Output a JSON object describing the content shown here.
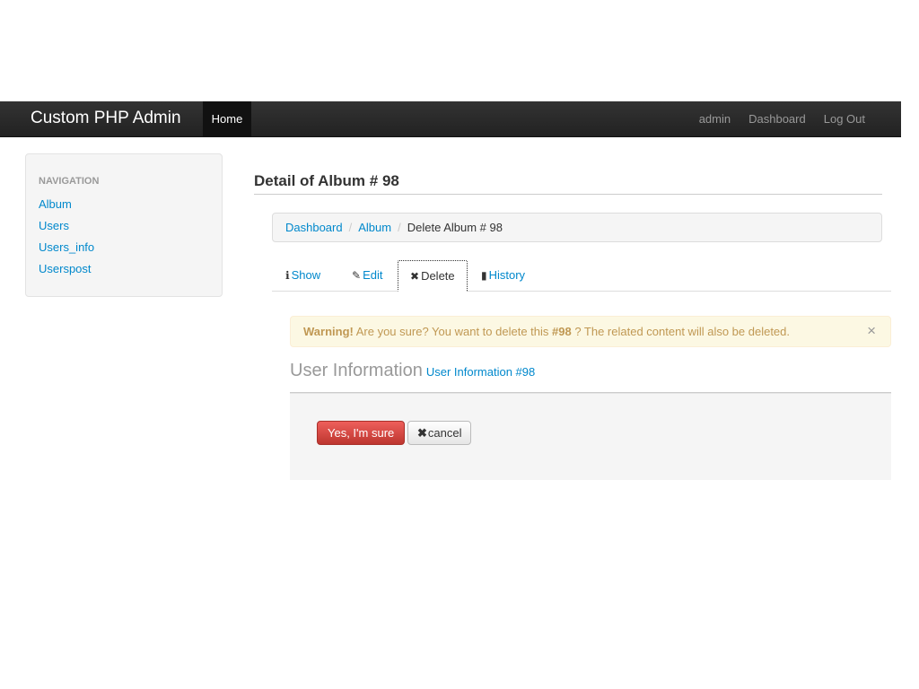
{
  "navbar": {
    "brand": "Custom PHP Admin",
    "home": "Home",
    "right_links": [
      "admin",
      "Dashboard",
      "Log Out"
    ]
  },
  "sidebar": {
    "header": "NAVIGATION",
    "items": [
      "Album",
      "Users",
      "Users_info",
      "Userspost"
    ]
  },
  "main": {
    "title": "Detail of Album # 98",
    "breadcrumb": {
      "items": [
        "Dashboard",
        "Album"
      ],
      "current": "Delete Album # 98",
      "separator": "/"
    },
    "tabs": [
      {
        "label": "Show",
        "icon": "info-circle-icon",
        "glyph": "ℹ"
      },
      {
        "label": "Edit",
        "icon": "pencil-icon",
        "glyph": "✎"
      },
      {
        "label": "Delete",
        "icon": "x-icon",
        "glyph": "✖"
      },
      {
        "label": "History",
        "icon": "book-icon",
        "glyph": "▮"
      }
    ],
    "alert": {
      "strong": "Warning!",
      "text_before": " Are you sure? You want to delete this ",
      "id": "#98",
      "text_after": " ? The related content will also be deleted.",
      "close": "×"
    },
    "section": {
      "title": "User Information",
      "subtitle": "User Information #98"
    },
    "buttons": {
      "confirm": "Yes, I'm sure",
      "cancel_icon": "✖",
      "cancel": "cancel"
    }
  },
  "colors": {
    "link": "#0088cc",
    "navbar": "#222222",
    "danger": "#bd362f",
    "warning_bg": "#fcf8e3",
    "warning_text": "#c09853"
  }
}
